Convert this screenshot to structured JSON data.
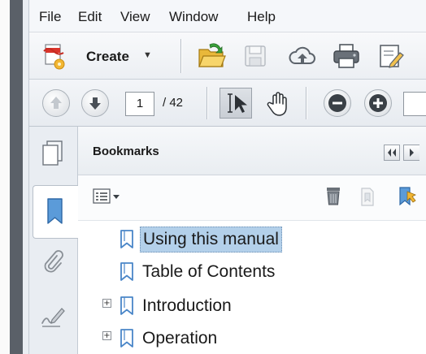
{
  "menubar": {
    "items": [
      "File",
      "Edit",
      "View",
      "Window",
      "Help"
    ]
  },
  "toolbar": {
    "create_label": "Create"
  },
  "navigation": {
    "current_page": "1",
    "total_pages": "/ 42"
  },
  "bookmarks_panel": {
    "title": "Bookmarks",
    "items": [
      {
        "label": "Using this manual",
        "selected": true,
        "expandable": false
      },
      {
        "label": "Table of Contents",
        "selected": false,
        "expandable": false
      },
      {
        "label": "Introduction",
        "selected": false,
        "expandable": true
      },
      {
        "label": "Operation",
        "selected": false,
        "expandable": true
      }
    ]
  },
  "colors": {
    "selection": "#b3d0ea",
    "bookmark_icon": "#4a86c8"
  }
}
